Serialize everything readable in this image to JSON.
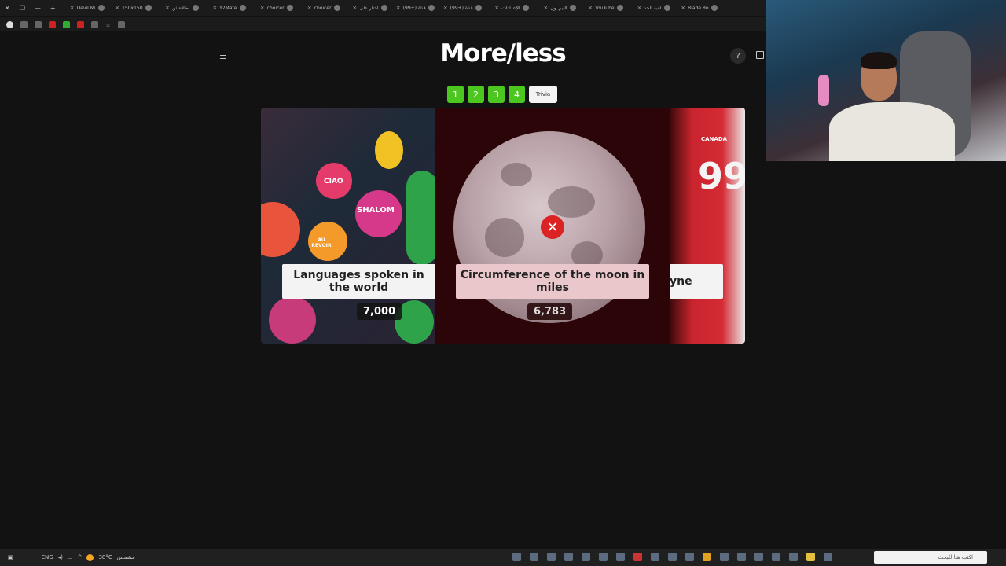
{
  "browser": {
    "tabs": [
      {
        "label": "Devil Mi"
      },
      {
        "label": "150x150"
      },
      {
        "label": "بطاقة ثن"
      },
      {
        "label": "Y2Mate"
      },
      {
        "label": "choicer"
      },
      {
        "label": "choicer"
      },
      {
        "label": "اختار على"
      },
      {
        "label": "(99+) قناة"
      },
      {
        "label": "(99+) قناة"
      },
      {
        "label": "الإعدادات"
      },
      {
        "label": "اليبي ون"
      },
      {
        "label": "YouTube"
      },
      {
        "label": "لعبة الحد"
      },
      {
        "label": "Blade Ro"
      }
    ]
  },
  "game": {
    "title": "More/less",
    "menu_icon": "≡",
    "help_label": "?",
    "levels": [
      "1",
      "2",
      "3",
      "4",
      "Trivia"
    ],
    "cards": [
      {
        "label": "Languages spoken in the world",
        "value": "7,000"
      },
      {
        "label": "Circumference of the moon in miles",
        "value": "6,783"
      },
      {
        "label": "yne"
      }
    ],
    "wrong_icon": "✕",
    "colors": {
      "level_green": "#4cc71f",
      "wrong_red": "#dc2323",
      "mid_card_bg": "#2b0508"
    }
  },
  "decor": {
    "left_card_signs": [
      "CIAO",
      "SHALOM",
      "AU REVOIR"
    ],
    "jersey_number": "99",
    "jersey_text": "CANADA"
  },
  "taskbar": {
    "lang": "ENG",
    "weather": "38°C",
    "weather_desc": "مشمس",
    "search_placeholder": "اكتب هنا للبحث"
  }
}
